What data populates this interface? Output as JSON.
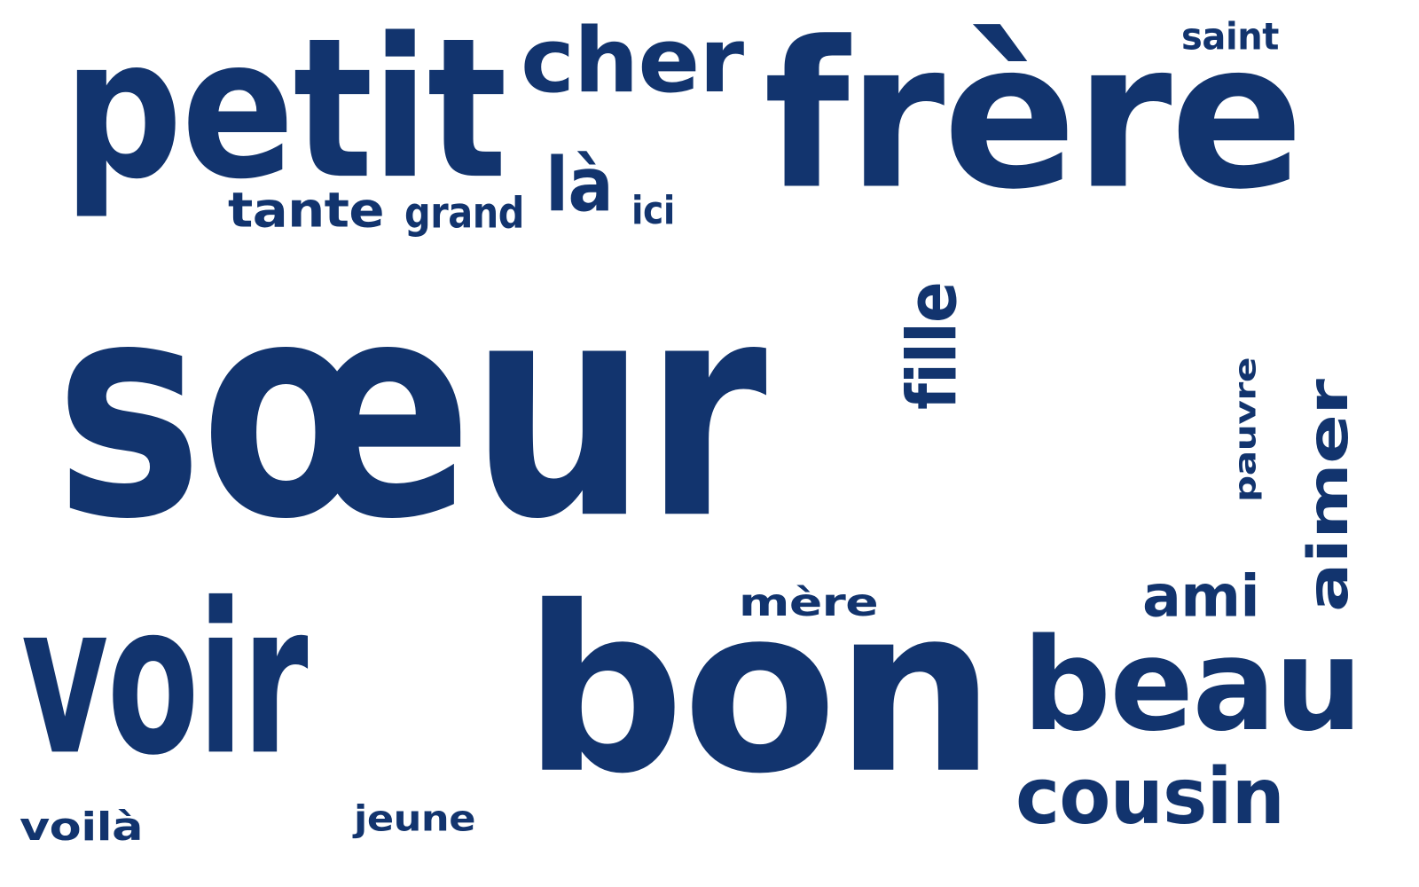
{
  "cloud": {
    "color": "#12346e",
    "words": [
      {
        "id": "soeur",
        "text": "sœur",
        "weight": 1.0
      },
      {
        "id": "voir",
        "text": "voir",
        "weight": 0.42
      },
      {
        "id": "bon",
        "text": "bon",
        "weight": 0.42
      },
      {
        "id": "frere",
        "text": "frère",
        "weight": 0.36
      },
      {
        "id": "petit",
        "text": "petit",
        "weight": 0.33
      },
      {
        "id": "beau",
        "text": "beau",
        "weight": 0.24
      },
      {
        "id": "cher",
        "text": "cher",
        "weight": 0.16
      },
      {
        "id": "aimer",
        "text": "aimer",
        "weight": 0.15
      },
      {
        "id": "la",
        "text": "là",
        "weight": 0.14
      },
      {
        "id": "cousin",
        "text": "cousin",
        "weight": 0.13
      },
      {
        "id": "fille",
        "text": "fille",
        "weight": 0.13
      },
      {
        "id": "tante",
        "text": "tante",
        "weight": 0.1
      },
      {
        "id": "ami",
        "text": "ami",
        "weight": 0.1
      },
      {
        "id": "pauvre",
        "text": "pauvre",
        "weight": 0.09
      },
      {
        "id": "mere",
        "text": "mère",
        "weight": 0.09
      },
      {
        "id": "voila",
        "text": "voilà",
        "weight": 0.08
      },
      {
        "id": "grand",
        "text": "grand",
        "weight": 0.07
      },
      {
        "id": "ici",
        "text": "ici",
        "weight": 0.07
      },
      {
        "id": "jeune",
        "text": "jeune",
        "weight": 0.07
      },
      {
        "id": "saint",
        "text": "saint",
        "weight": 0.07
      }
    ]
  }
}
